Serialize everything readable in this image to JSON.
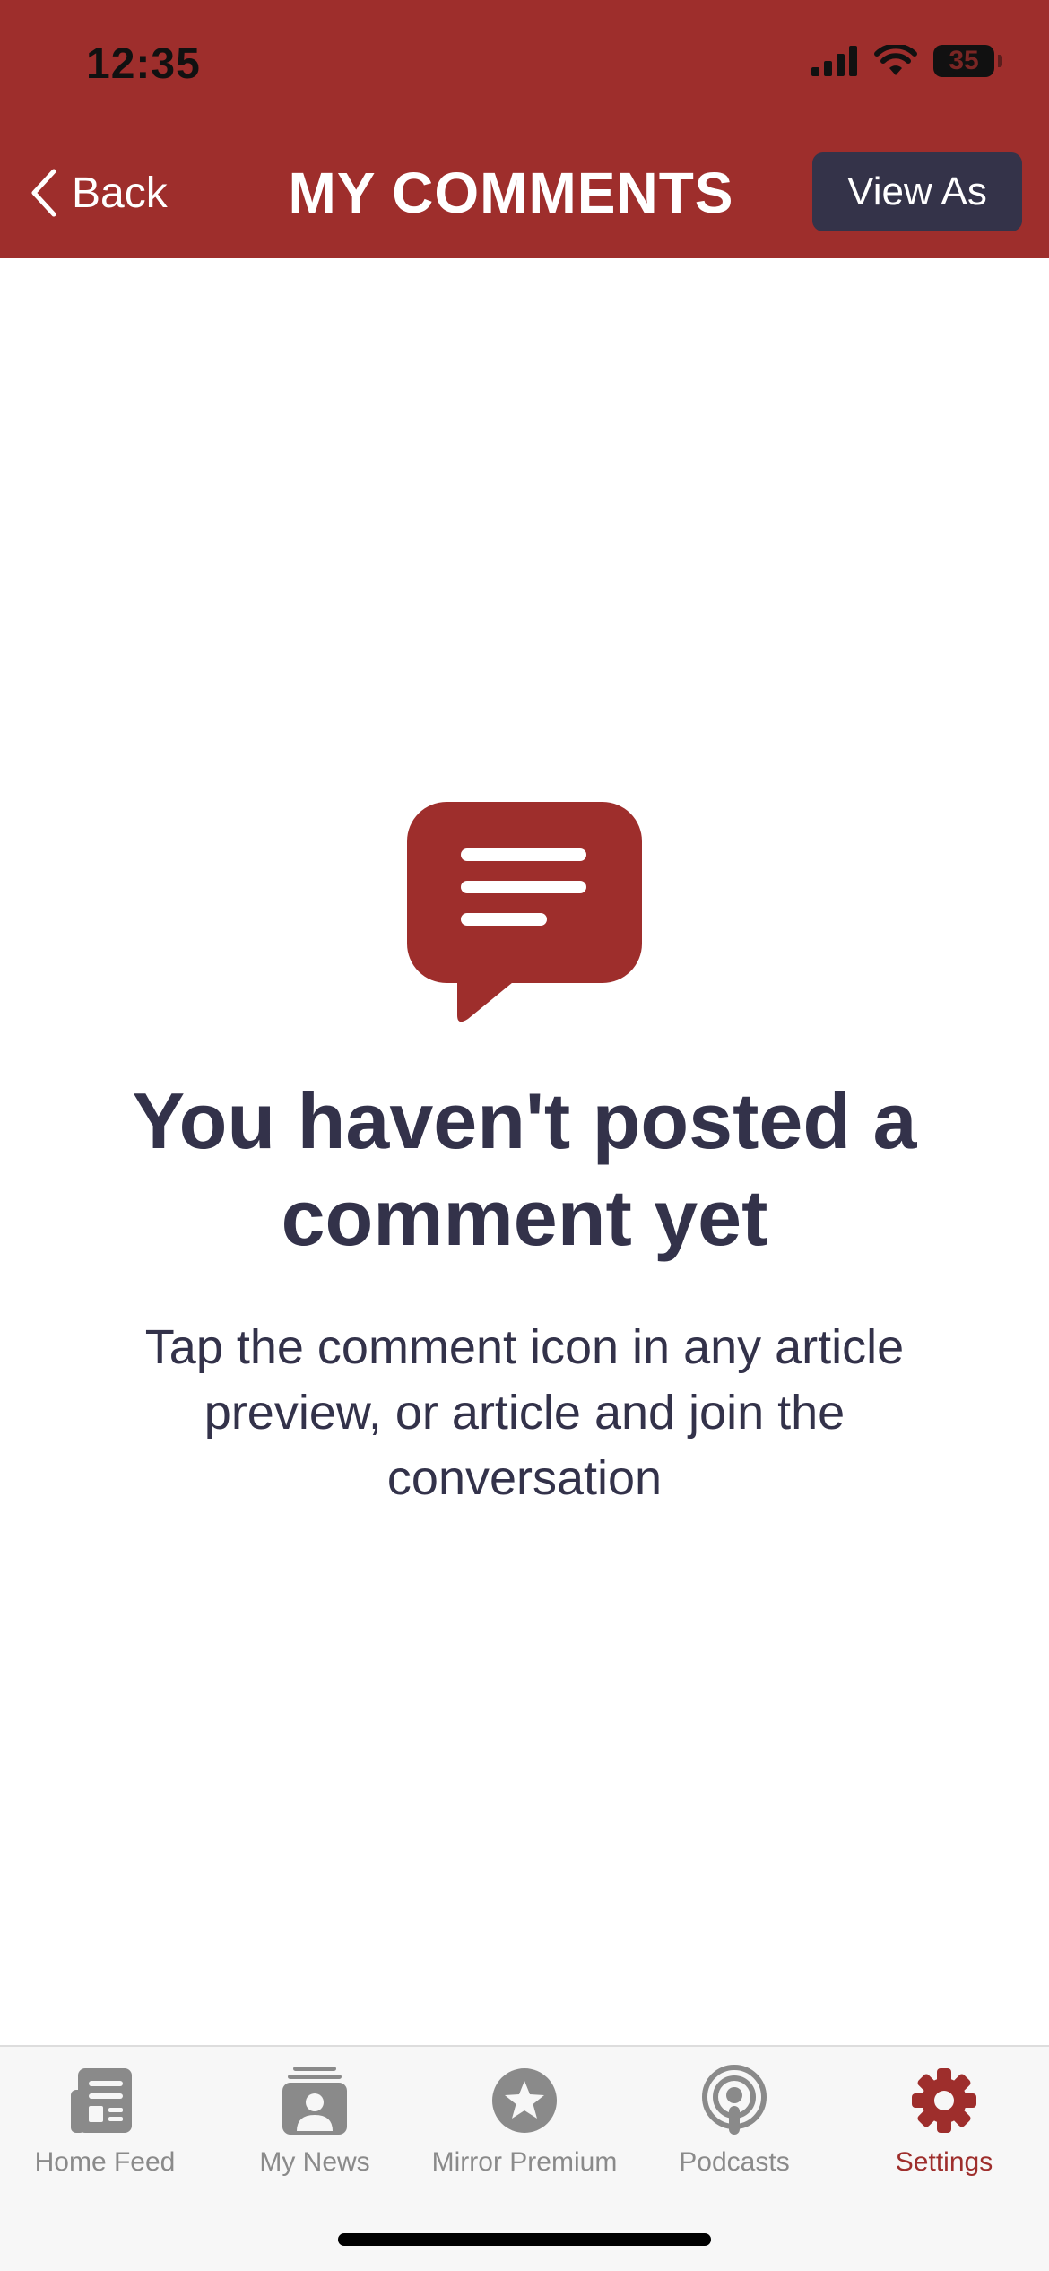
{
  "status_bar": {
    "time": "12:35",
    "battery": "35"
  },
  "header": {
    "back_label": "Back",
    "title": "MY COMMENTS",
    "view_as_label": "View As"
  },
  "empty_state": {
    "title": "You haven't posted a comment yet",
    "description": "Tap the comment icon in any article preview, or article and join the conversation"
  },
  "tab_bar": {
    "items": [
      {
        "label": "Home Feed",
        "icon": "newspaper-icon"
      },
      {
        "label": "My News",
        "icon": "person-stack-icon"
      },
      {
        "label": "Mirror Premium",
        "icon": "star-circle-icon"
      },
      {
        "label": "Podcasts",
        "icon": "podcast-icon"
      },
      {
        "label": "Settings",
        "icon": "gear-icon"
      }
    ],
    "active_index": 4
  },
  "colors": {
    "brand_red": "#9e2e2c",
    "navy": "#343349",
    "text_dark": "#33324a",
    "tab_inactive": "#8a8a8a"
  }
}
